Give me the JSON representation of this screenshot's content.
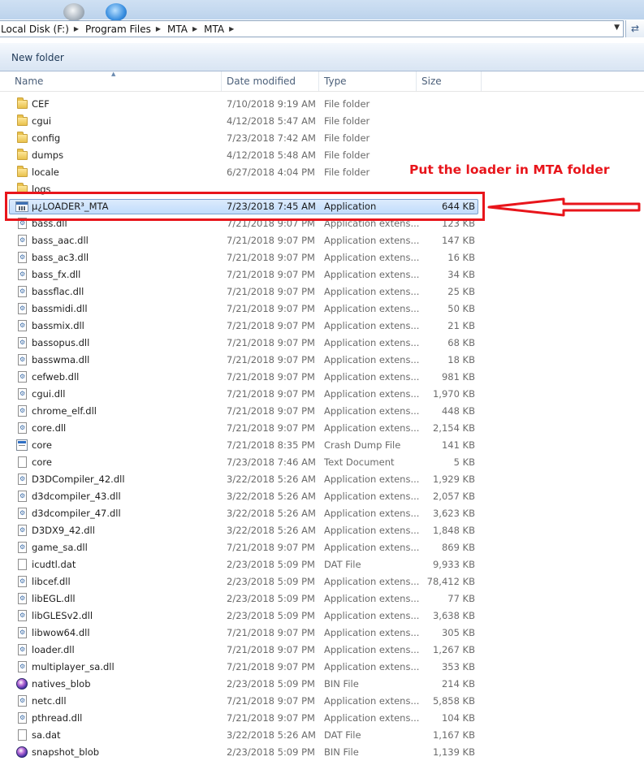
{
  "address": {
    "crumbs": [
      "Local Disk (F:)",
      "Program Files",
      "MTA",
      "MTA"
    ]
  },
  "commandbar": {
    "new_folder": "New folder"
  },
  "columns": {
    "name": "Name",
    "date": "Date modified",
    "type": "Type",
    "size": "Size"
  },
  "files": [
    {
      "name": "CEF",
      "date": "7/10/2018 9:19 AM",
      "type": "File folder",
      "size": "",
      "icon": "folder-icon"
    },
    {
      "name": "cgui",
      "date": "4/12/2018 5:47 AM",
      "type": "File folder",
      "size": "",
      "icon": "folder-icon"
    },
    {
      "name": "config",
      "date": "7/23/2018 7:42 AM",
      "type": "File folder",
      "size": "",
      "icon": "folder-icon"
    },
    {
      "name": "dumps",
      "date": "4/12/2018 5:48 AM",
      "type": "File folder",
      "size": "",
      "icon": "folder-icon"
    },
    {
      "name": "locale",
      "date": "6/27/2018 4:04 PM",
      "type": "File folder",
      "size": "",
      "icon": "folder-icon"
    },
    {
      "name": "logs",
      "date": "",
      "type": "",
      "size": "",
      "icon": "folder-icon"
    },
    {
      "name": "µ¿LOADER³_MTA",
      "date": "7/23/2018 7:45 AM",
      "type": "Application",
      "size": "644 KB",
      "icon": "application-icon",
      "selected": true
    },
    {
      "name": "bass.dll",
      "date": "7/21/2018 9:07 PM",
      "type": "Application extens...",
      "size": "123 KB",
      "icon": "dll-icon"
    },
    {
      "name": "bass_aac.dll",
      "date": "7/21/2018 9:07 PM",
      "type": "Application extens...",
      "size": "147 KB",
      "icon": "dll-icon"
    },
    {
      "name": "bass_ac3.dll",
      "date": "7/21/2018 9:07 PM",
      "type": "Application extens...",
      "size": "16 KB",
      "icon": "dll-icon"
    },
    {
      "name": "bass_fx.dll",
      "date": "7/21/2018 9:07 PM",
      "type": "Application extens...",
      "size": "34 KB",
      "icon": "dll-icon"
    },
    {
      "name": "bassflac.dll",
      "date": "7/21/2018 9:07 PM",
      "type": "Application extens...",
      "size": "25 KB",
      "icon": "dll-icon"
    },
    {
      "name": "bassmidi.dll",
      "date": "7/21/2018 9:07 PM",
      "type": "Application extens...",
      "size": "50 KB",
      "icon": "dll-icon"
    },
    {
      "name": "bassmix.dll",
      "date": "7/21/2018 9:07 PM",
      "type": "Application extens...",
      "size": "21 KB",
      "icon": "dll-icon"
    },
    {
      "name": "bassopus.dll",
      "date": "7/21/2018 9:07 PM",
      "type": "Application extens...",
      "size": "68 KB",
      "icon": "dll-icon"
    },
    {
      "name": "basswma.dll",
      "date": "7/21/2018 9:07 PM",
      "type": "Application extens...",
      "size": "18 KB",
      "icon": "dll-icon"
    },
    {
      "name": "cefweb.dll",
      "date": "7/21/2018 9:07 PM",
      "type": "Application extens...",
      "size": "981 KB",
      "icon": "dll-icon"
    },
    {
      "name": "cgui.dll",
      "date": "7/21/2018 9:07 PM",
      "type": "Application extens...",
      "size": "1,970 KB",
      "icon": "dll-icon"
    },
    {
      "name": "chrome_elf.dll",
      "date": "7/21/2018 9:07 PM",
      "type": "Application extens...",
      "size": "448 KB",
      "icon": "dll-icon"
    },
    {
      "name": "core.dll",
      "date": "7/21/2018 9:07 PM",
      "type": "Application extens...",
      "size": "2,154 KB",
      "icon": "dll-icon"
    },
    {
      "name": "core",
      "date": "7/21/2018 8:35 PM",
      "type": "Crash Dump File",
      "size": "141 KB",
      "icon": "crash-dump-icon"
    },
    {
      "name": "core",
      "date": "7/23/2018 7:46 AM",
      "type": "Text Document",
      "size": "5 KB",
      "icon": "text-document-icon"
    },
    {
      "name": "D3DCompiler_42.dll",
      "date": "3/22/2018 5:26 AM",
      "type": "Application extens...",
      "size": "1,929 KB",
      "icon": "dll-icon"
    },
    {
      "name": "d3dcompiler_43.dll",
      "date": "3/22/2018 5:26 AM",
      "type": "Application extens...",
      "size": "2,057 KB",
      "icon": "dll-icon"
    },
    {
      "name": "d3dcompiler_47.dll",
      "date": "3/22/2018 5:26 AM",
      "type": "Application extens...",
      "size": "3,623 KB",
      "icon": "dll-icon"
    },
    {
      "name": "D3DX9_42.dll",
      "date": "3/22/2018 5:26 AM",
      "type": "Application extens...",
      "size": "1,848 KB",
      "icon": "dll-icon"
    },
    {
      "name": "game_sa.dll",
      "date": "7/21/2018 9:07 PM",
      "type": "Application extens...",
      "size": "869 KB",
      "icon": "dll-icon"
    },
    {
      "name": "icudtl.dat",
      "date": "2/23/2018 5:09 PM",
      "type": "DAT File",
      "size": "9,933 KB",
      "icon": "file-icon"
    },
    {
      "name": "libcef.dll",
      "date": "2/23/2018 5:09 PM",
      "type": "Application extens...",
      "size": "78,412 KB",
      "icon": "dll-icon"
    },
    {
      "name": "libEGL.dll",
      "date": "2/23/2018 5:09 PM",
      "type": "Application extens...",
      "size": "77 KB",
      "icon": "dll-icon"
    },
    {
      "name": "libGLESv2.dll",
      "date": "2/23/2018 5:09 PM",
      "type": "Application extens...",
      "size": "3,638 KB",
      "icon": "dll-icon"
    },
    {
      "name": "libwow64.dll",
      "date": "7/21/2018 9:07 PM",
      "type": "Application extens...",
      "size": "305 KB",
      "icon": "dll-icon"
    },
    {
      "name": "loader.dll",
      "date": "7/21/2018 9:07 PM",
      "type": "Application extens...",
      "size": "1,267 KB",
      "icon": "dll-icon"
    },
    {
      "name": "multiplayer_sa.dll",
      "date": "7/21/2018 9:07 PM",
      "type": "Application extens...",
      "size": "353 KB",
      "icon": "dll-icon"
    },
    {
      "name": "natives_blob",
      "date": "2/23/2018 5:09 PM",
      "type": "BIN File",
      "size": "214 KB",
      "icon": "bin-file-icon"
    },
    {
      "name": "netc.dll",
      "date": "7/21/2018 9:07 PM",
      "type": "Application extens...",
      "size": "5,858 KB",
      "icon": "dll-icon"
    },
    {
      "name": "pthread.dll",
      "date": "7/21/2018 9:07 PM",
      "type": "Application extens...",
      "size": "104 KB",
      "icon": "dll-icon"
    },
    {
      "name": "sa.dat",
      "date": "3/22/2018 5:26 AM",
      "type": "DAT File",
      "size": "1,167 KB",
      "icon": "file-icon"
    },
    {
      "name": "snapshot_blob",
      "date": "2/23/2018 5:09 PM",
      "type": "BIN File",
      "size": "1,139 KB",
      "icon": "bin-file-icon"
    }
  ],
  "annotation": {
    "text": "Put the loader in MTA folder",
    "color": "#e8151b"
  },
  "colors": {
    "selection": "#c1dcfc",
    "selection_border": "#7da2ce",
    "muted_text": "#6b6b6b"
  }
}
